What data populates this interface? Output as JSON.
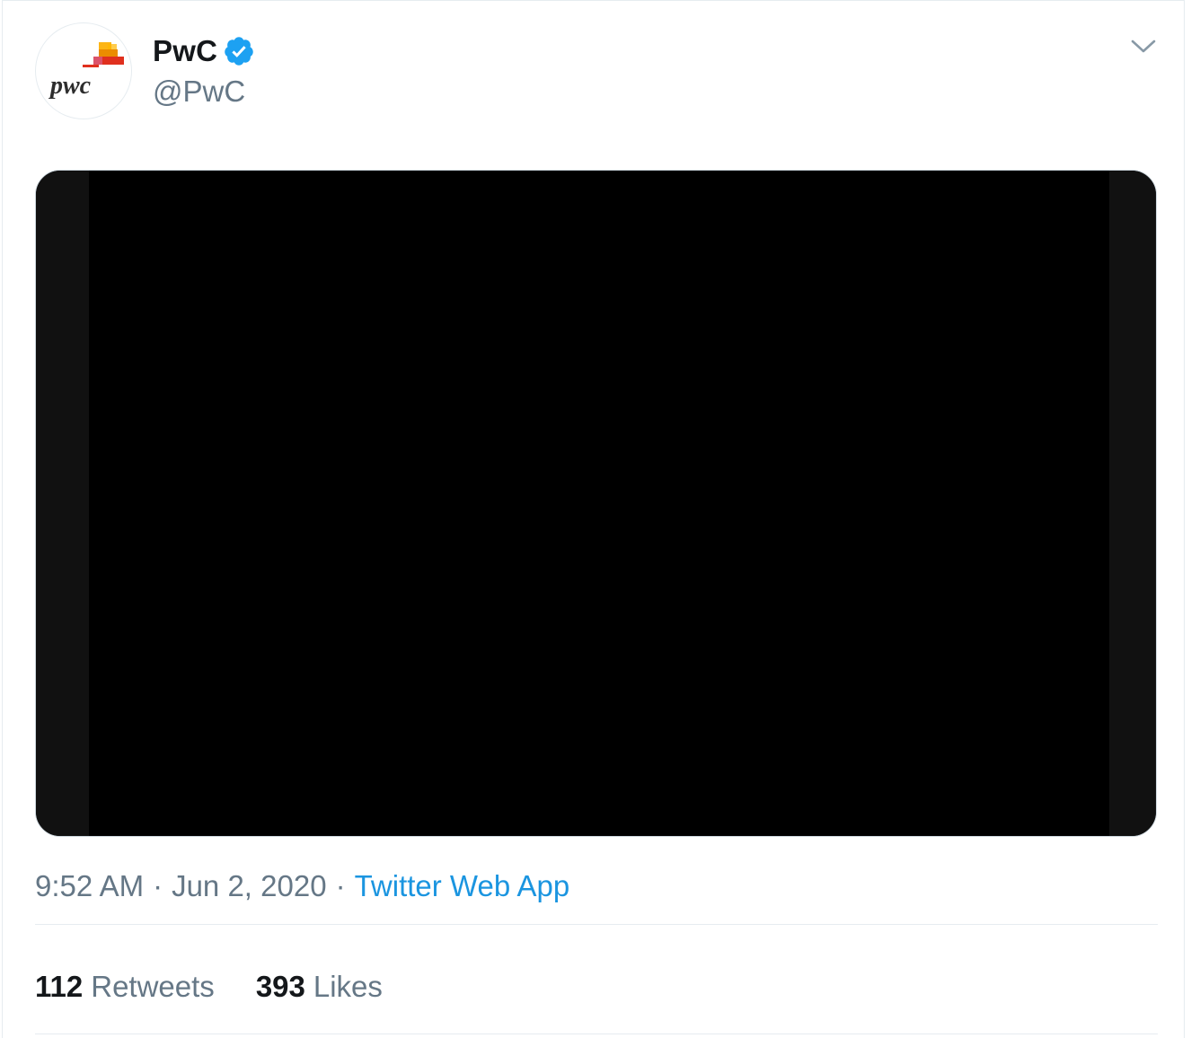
{
  "author": {
    "display_name": "PwC",
    "handle": "@PwC",
    "verified": true,
    "avatar_logo_text": "pwc"
  },
  "media": {
    "kind": "video",
    "state": "black-frame"
  },
  "meta": {
    "time": "9:52 AM",
    "separator": "·",
    "date": "Jun 2, 2020",
    "source": "Twitter Web App"
  },
  "stats": {
    "retweets_count": "112",
    "retweets_label": "Retweets",
    "likes_count": "393",
    "likes_label": "Likes"
  },
  "icons": {
    "verified": "verified-badge-icon",
    "more": "chevron-down-icon"
  },
  "colors": {
    "verified_blue": "#1da1f2",
    "link_blue": "#1b95e0",
    "secondary_text": "#657786",
    "primary_text": "#14171a",
    "divider": "#e6ecf0"
  }
}
